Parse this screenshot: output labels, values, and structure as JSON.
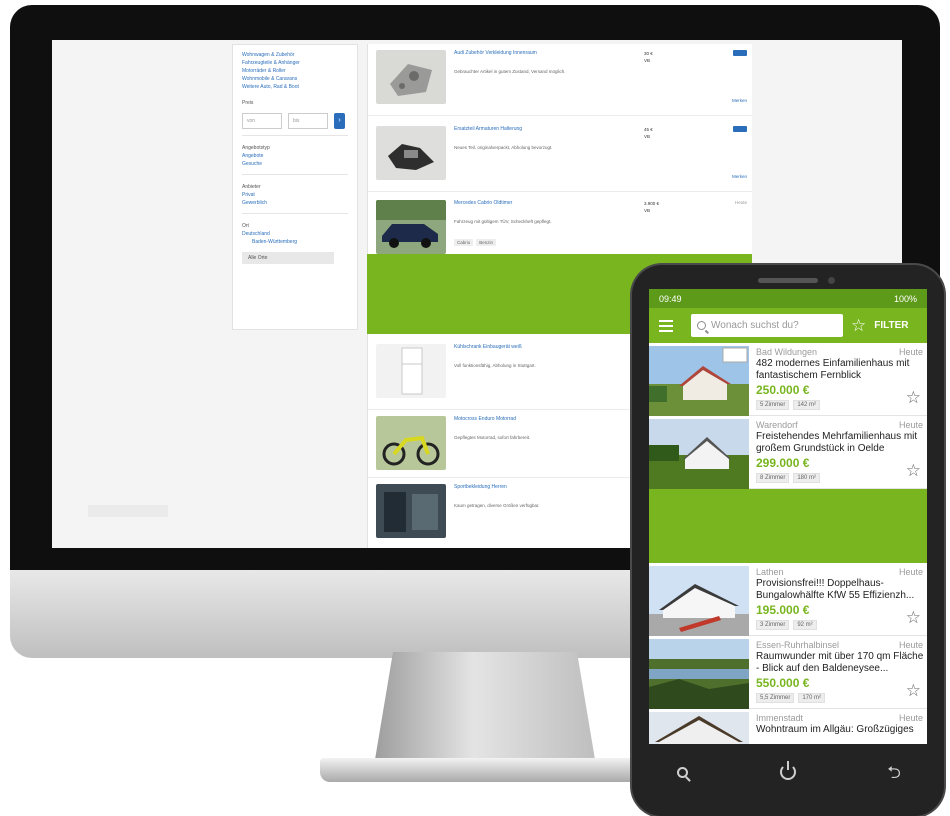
{
  "colors": {
    "brand_green": "#78b51f",
    "status_green": "#5e9a1a",
    "link_blue": "#2a6ebb",
    "monitor_bezel": "#0f0f0f",
    "phone_body": "#232323"
  },
  "desktop": {
    "filter_panel": {
      "category_links": [
        "Wohnwagen & Zubehör",
        "Fahrzeugteile & Anhänger",
        "Motorräder & Roller",
        "Wohnmobile & Caravans",
        "Weitere Auto, Rad & Boot"
      ],
      "price_heading": "Preis",
      "price_from_placeholder": "von",
      "price_to_placeholder": "bis",
      "price_submit": "›",
      "type_heading": "Angebotstyp",
      "type_links": [
        "Angebote",
        "Gesuche"
      ],
      "seller_heading": "Anbieter",
      "seller_links": [
        "Privat",
        "Gewerblich"
      ],
      "location_heading": "Ort",
      "location_links": [
        "Deutschland",
        "Baden-Württemberg"
      ],
      "radius_select": "Alle Orte"
    },
    "listings": [
      {
        "title": "Audi Zubehör Verkleidung Innenraum",
        "desc": "Gebrauchter Artikel in gutem Zustand, Versand möglich.",
        "price": "30 €",
        "meta": "VB",
        "action": "Merken",
        "thumb": "part-photo"
      },
      {
        "title": "Ersatzteil Armaturen Halterung",
        "desc": "Neues Teil, originalverpackt, Abholung bevorzugt.",
        "price": "45 €",
        "meta": "VB",
        "action": "Merken",
        "thumb": "part-photo"
      },
      {
        "title": "Mercedes Cabrio Oldtimer",
        "desc": "Fahrzeug mit gültigem TÜV, Scheckheft gepflegt.",
        "price": "3.900 €",
        "meta": "VB",
        "date": "Heute",
        "chips": [
          "Cabrio",
          "Benzin"
        ],
        "thumb": "car-photo"
      },
      {
        "title": "Kühlschrank Einbaugerät weiß",
        "desc": "Voll funktionsfähig, Abholung in Stuttgart.",
        "price": "",
        "meta": "",
        "thumb": "fridge-photo"
      },
      {
        "title": "Motocross Enduro Motorrad",
        "desc": "Gepflegtes Motorrad, sofort fahrbereit.",
        "price": "",
        "meta": "",
        "thumb": "bike-photo"
      },
      {
        "title": "Sportbekleidung Herren",
        "desc": "Kaum getragen, diverse Größen verfügbar.",
        "price": "",
        "meta": "",
        "thumb": "clothes-photo"
      }
    ]
  },
  "phone": {
    "status": {
      "time": "09:49",
      "battery": "100%"
    },
    "search_placeholder": "Wonach suchst du?",
    "filter_label": "FILTER",
    "listings": [
      {
        "location": "Bad Wildungen",
        "date": "Heute",
        "title": "482 modernes Einfamilienhaus mit fantastischem Fernblick",
        "price": "250.000 €",
        "chips": [
          "5 Zimmer",
          "142 m²"
        ],
        "thumb": "house-1"
      },
      {
        "location": "Warendorf",
        "date": "Heute",
        "title": "Freistehendes Mehrfamilienhaus mit großem Grundstück in Oelde",
        "price": "299.000 €",
        "chips": [
          "8 Zimmer",
          "180 m²"
        ],
        "thumb": "house-2"
      },
      {
        "location": "Lathen",
        "date": "Heute",
        "title": "Provisionsfrei!!! Doppelhaus-Bungalowhälfte KfW 55 Effizienzh...",
        "price": "195.000 €",
        "chips": [
          "3 Zimmer",
          "92 m²"
        ],
        "thumb": "house-3"
      },
      {
        "location": "Essen-Ruhrhalbinsel",
        "date": "Heute",
        "title": "Raumwunder mit über 170 qm Fläche - Blick auf den Baldeneysee...",
        "price": "550.000 €",
        "chips": [
          "5,5 Zimmer",
          "170 m²"
        ],
        "thumb": "house-4"
      },
      {
        "location": "Immenstadt",
        "date": "Heute",
        "title": "Wohntraum im Allgäu: Großzügiges",
        "price": "",
        "chips": [],
        "thumb": "house-5"
      }
    ]
  }
}
